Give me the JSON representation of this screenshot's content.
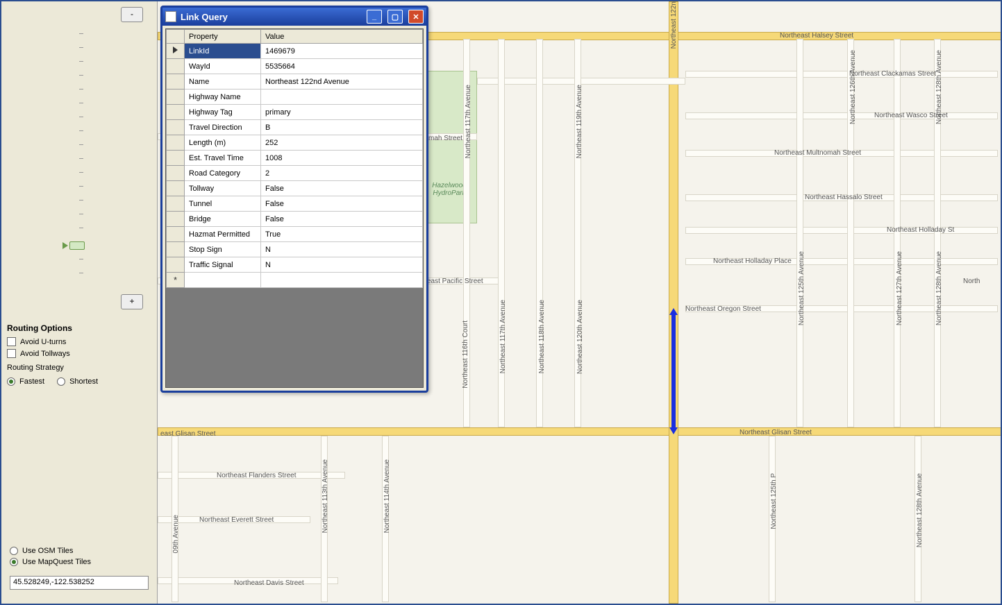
{
  "sidebar": {
    "zoom_out": "-",
    "zoom_in": "+",
    "routing": {
      "heading": "Routing Options",
      "avoid_u": "Avoid U-turns",
      "avoid_toll": "Avoid Tollways",
      "strategy_label": "Routing Strategy",
      "fastest": "Fastest",
      "shortest": "Shortest"
    },
    "tiles": {
      "osm": "Use OSM Tiles",
      "mapquest": "Use MapQuest Tiles"
    },
    "coords": "45.528249,-122.538252"
  },
  "dialog": {
    "title": "Link Query",
    "columns": {
      "prop": "Property",
      "val": "Value"
    },
    "rows": [
      {
        "prop": "LinkId",
        "val": "1469679"
      },
      {
        "prop": "WayId",
        "val": "5535664"
      },
      {
        "prop": "Name",
        "val": "Northeast 122nd Avenue"
      },
      {
        "prop": "Highway Name",
        "val": ""
      },
      {
        "prop": "Highway Tag",
        "val": "primary"
      },
      {
        "prop": "Travel Direction",
        "val": "B"
      },
      {
        "prop": "Length (m)",
        "val": "252"
      },
      {
        "prop": "Est. Travel Time",
        "val": "1008"
      },
      {
        "prop": "Road Category",
        "val": "2"
      },
      {
        "prop": "Tollway",
        "val": "False"
      },
      {
        "prop": "Tunnel",
        "val": "False"
      },
      {
        "prop": "Bridge",
        "val": "False"
      },
      {
        "prop": "Hazmat Permitted",
        "val": "True"
      },
      {
        "prop": "Stop Sign",
        "val": "N"
      },
      {
        "prop": "Traffic Signal",
        "val": "N"
      }
    ]
  },
  "map": {
    "park": "Hazelwood HydroPark",
    "streets": {
      "halsey": "Northeast Halsey Street",
      "clackamas": "Northeast Clackamas Street",
      "wasco": "Northeast Wasco Street",
      "multnomah": "Northeast Multnomah Street",
      "pacific": "east Pacific Street",
      "mah": "mah Street",
      "hassalo": "Northeast Hassalo Street",
      "holladay": "Northeast Holladay St",
      "holladay_pl": "Northeast Holladay Place",
      "oregon": "Northeast Oregon Street",
      "glisan_w": "east Glisan Street",
      "glisan_e": "Northeast Glisan Street",
      "flanders": "Northeast Flanders Street",
      "everett": "Northeast Everett Street",
      "davis": "Northeast Davis Street",
      "north": "North",
      "av122": "Northeast 122n",
      "av117": "Northeast 117th Avenue",
      "av118": "Northeast 118th Avenue",
      "av119": "Northeast 119th Avenue",
      "av120": "Northeast 120th Avenue",
      "av125": "Northeast 125th Avenue",
      "av126": "Northeast 126th Avenue",
      "av127": "Northeast 127th Avenue",
      "av128": "Northeast 128th Avenue",
      "av128b": "Northeast 128th Avenue",
      "av117b": "Northeast 117th Avenue",
      "av116ct": "Northeast 116th Court",
      "av113": "Northeast 113th Avenue",
      "av114": "Northeast 114th Avenue",
      "av109": "09th Avenue",
      "av125p": "Northeast 125th P"
    }
  }
}
